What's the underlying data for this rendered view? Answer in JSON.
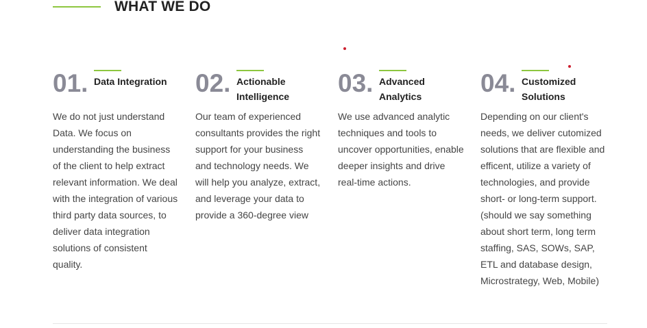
{
  "section": {
    "title": "WHAT WE DO",
    "accent_color": "#8dc63f",
    "dot_color": "#cc1f2f"
  },
  "cards": [
    {
      "number": "01.",
      "title": "Data Integration",
      "text": "We do not just understand\nData. We focus on\nunderstanding the business\nof the client to help extract\nrelevant information. We deal\nwith the integration of various\nthird party data sources, to\ndeliver data integration\nsolutions of consistent\nquality."
    },
    {
      "number": "02.",
      "title": "Actionable\nIntelligence",
      "text": "Our team of experienced\nconsultants provides the right\nsupport for your business\nand technology needs. We\nwill help you analyze, extract,\nand leverage your data to\nprovide a 360-degree view"
    },
    {
      "number": "03.",
      "title": "Advanced\nAnalytics",
      "text": "We use advanced analytic\ntechniques and tools to\nuncover opportunities, enable\ndeeper insights and drive\nreal-time actions."
    },
    {
      "number": "04.",
      "title": "Customized\nSolutions",
      "text": "Depending on our client's\nneeds, we deliver cutomized\nsolutions that are flexible and\nefficent, utilize a variety of\ntechnologies, and provide\nshort- or long-term support.\n(should we say something\nabout short term, long term\nstaffing, SAS, SOWs, SAP,\nETL and database design,\nMicrostrategy, Web, Mobile)"
    }
  ]
}
